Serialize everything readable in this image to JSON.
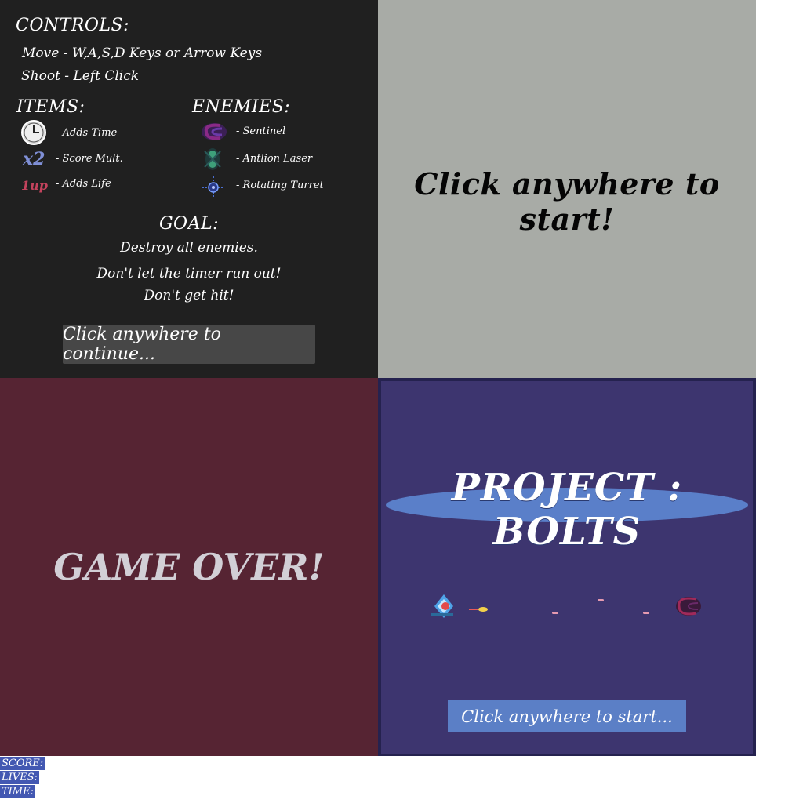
{
  "instructions": {
    "controls_heading": "CONTROLS:",
    "controls": [
      "Move - W,A,S,D Keys or Arrow Keys",
      "Shoot - Left Click"
    ],
    "items_heading": "ITEMS:",
    "items": [
      {
        "icon": "clock-icon",
        "label": "- Adds Time"
      },
      {
        "icon": "x2-icon",
        "glyph": "x2",
        "label": "- Score Mult."
      },
      {
        "icon": "1up-icon",
        "glyph": "1up",
        "label": "- Adds Life"
      }
    ],
    "enemies_heading": "ENEMIES:",
    "enemies": [
      {
        "icon": "sentinel-icon",
        "label": "- Sentinel"
      },
      {
        "icon": "antlion-laser-icon",
        "label": "- Antlion Laser"
      },
      {
        "icon": "rotating-turret-icon",
        "label": "- Rotating Turret"
      }
    ],
    "goal_heading": "GOAL:",
    "goals": [
      "Destroy all enemies.",
      "Don't let the timer run out!",
      "Don't get hit!"
    ],
    "continue_label": "Click anywhere to continue..."
  },
  "start_panel": {
    "prompt": "Click anywhere to start!"
  },
  "gameover_panel": {
    "text": "GAME OVER!"
  },
  "title_panel": {
    "title": "PROJECT : BOLTS",
    "start_label": "Click anywhere to start..."
  },
  "hud": {
    "score_label": "SCORE:",
    "lives_label": "LIVES:",
    "time_label": "TIME:"
  },
  "colors": {
    "instructions_bg": "#202020",
    "start_bg": "#a8aba6",
    "gameover_bg": "#562433",
    "title_bg": "#3d356f",
    "accent_blue": "#5b7fc6",
    "hud_bg": "#4358b2"
  }
}
